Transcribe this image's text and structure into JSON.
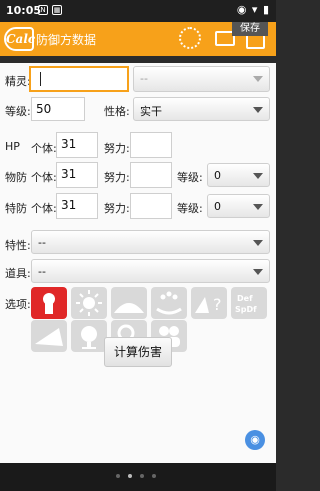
{
  "status": {
    "time": "10:05",
    "right_icons": "◉ ▾ ▮"
  },
  "app": {
    "logo_text": "Calc",
    "title": "防御方数据",
    "save_label": "保存"
  },
  "form": {
    "jingling_label": "精灵:",
    "jingling_value": "",
    "jingling_select": "--",
    "level_label": "等级:",
    "level_value": "50",
    "nature_label": "性格:",
    "nature_value": "实干",
    "hp_label": "HP",
    "iv_label": "个体:",
    "ev_label": "努力:",
    "hp_iv": "31",
    "hp_ev": "",
    "def_label": "物防",
    "def_iv": "31",
    "def_ev": "",
    "def_rank_label": "等级:",
    "def_rank": "0",
    "spdef_label": "特防",
    "spdef_iv": "31",
    "spdef_ev": "",
    "spdef_rank_label": "等级:",
    "spdef_rank": "0",
    "ability_label": "特性:",
    "ability_value": "--",
    "item_label": "道具:",
    "item_value": "--",
    "options_label": "选项:",
    "options": [
      {
        "icon": "keyhole-icon",
        "active": true
      },
      {
        "icon": "sun-icon",
        "active": false
      },
      {
        "icon": "ground-icon",
        "active": false
      },
      {
        "icon": "splash-icon",
        "active": false
      },
      {
        "icon": "question-pair-icon",
        "active": false
      },
      {
        "icon": "def-spdef-icon",
        "text": "Def SpDf",
        "active": false
      },
      {
        "icon": "screen-icon",
        "active": false
      },
      {
        "icon": "globe-icon",
        "active": false
      },
      {
        "icon": "magnifier-icon",
        "active": false
      },
      {
        "icon": "friends-icon",
        "active": false
      }
    ],
    "calc_button": "计算伤害"
  },
  "colors": {
    "accent": "#f7a11a",
    "active_option": "#e02727"
  }
}
